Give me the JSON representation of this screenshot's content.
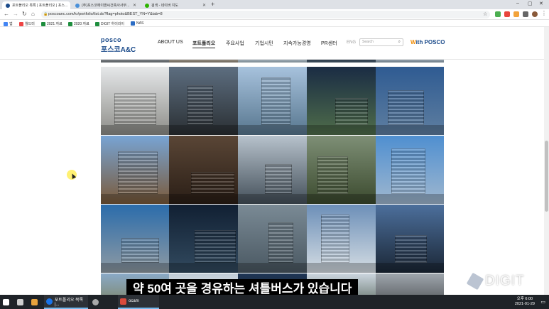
{
  "browser": {
    "tabs": [
      {
        "label": "포트폴리오 목록 | 포트폴리오 | 포스...",
        "active": true,
        "color": "#1a4a8a"
      },
      {
        "label": "(주)포스코에이앤씨건축사사무...",
        "active": false,
        "color": "#4a90d9"
      },
      {
        "label": "검색 - 네이버 지도",
        "active": false,
        "color": "#2db400"
      }
    ],
    "new_tab": "+",
    "url": "poscoanc.com/kr/portfolio/list.do?flag=photo&BEST_YN=Y&tab=8",
    "bookmarks": [
      {
        "label": "앱",
        "color": "#4285f4"
      },
      {
        "label": "월드미",
        "color": "#e44"
      },
      {
        "label": "2021 자료",
        "color": "#1e8e3e"
      },
      {
        "label": "2020 자료",
        "color": "#1e8e3e"
      },
      {
        "label": "DIGIT 하이라이",
        "color": "#1e8e3e"
      },
      {
        "label": "NAS",
        "color": "#2b6cc4"
      }
    ]
  },
  "site": {
    "logo_top": "posco",
    "logo_bottom": "포스코A&C",
    "menu": [
      "ABOUT US",
      "포트폴리오",
      "주요사업",
      "기업시민",
      "지속가능경영",
      "PR센터"
    ],
    "active_menu_index": 1,
    "lang": "ENG",
    "search_placeholder": "Search",
    "with_posco_prefix": "W",
    "with_posco": "ith POSCO"
  },
  "gallery": {
    "tiles": [
      {
        "top": "#9fa6ad",
        "bottom": "#5b5f63"
      },
      {
        "top": "#c7c3b9",
        "bottom": "#6e665b"
      },
      {
        "top": "#cfe0ee",
        "bottom": "#7d8a92"
      },
      {
        "top": "#1c2a3c",
        "bottom": "#3c4c5a"
      },
      {
        "top": "#c9d8e6",
        "bottom": "#6d7b86"
      },
      {
        "top": "#e6e8ea",
        "bottom": "#8d8d88"
      },
      {
        "top": "#5d6e80",
        "bottom": "#2a2f33"
      },
      {
        "top": "#a7c2dd",
        "bottom": "#57768e"
      },
      {
        "top": "#1a2c44",
        "bottom": "#4f6d4a"
      },
      {
        "top": "#2f5b92",
        "bottom": "#5e7ea0"
      },
      {
        "top": "#78a4d4",
        "bottom": "#7a5a3a"
      },
      {
        "top": "#5a4636",
        "bottom": "#2a1e16"
      },
      {
        "top": "#b7c2cc",
        "bottom": "#44505a"
      },
      {
        "top": "#7e8f76",
        "bottom": "#3b4a2e"
      },
      {
        "top": "#4f8fd0",
        "bottom": "#9fb7cf"
      },
      {
        "top": "#2b6cab",
        "bottom": "#8e9aa3"
      },
      {
        "top": "#112033",
        "bottom": "#324a5f"
      },
      {
        "top": "#7a8a95",
        "bottom": "#4a5862"
      },
      {
        "top": "#6c8fb8",
        "bottom": "#d5dde3"
      },
      {
        "top": "#4c6f9c",
        "bottom": "#1b2736"
      },
      {
        "top": "#8aa9c7",
        "bottom": "#7f8a72"
      },
      {
        "top": "#c0ccd6",
        "bottom": "#e8ecef"
      },
      {
        "top": "#1e3656",
        "bottom": "#1a2028"
      },
      {
        "top": "#ccd6df",
        "bottom": "#6f7d76"
      }
    ]
  },
  "subtitle": "약 50여 곳을 경유하는 셔틀버스가 있습니다",
  "watermark": "DIGIT",
  "taskbar": {
    "items": [
      {
        "label": "",
        "color": "#ffffff"
      },
      {
        "label": "",
        "color": "#cfcfcf"
      },
      {
        "label": "",
        "color": "#e8a33d"
      },
      {
        "label": "포트폴리오 목록 |...",
        "color": "#1a73e8"
      },
      {
        "label": "",
        "color": "#a9a9a9"
      },
      {
        "label": "ocam",
        "color": "#d94b3c"
      }
    ],
    "clock_time": "오후 6:00",
    "clock_date": "2021-01-29"
  }
}
